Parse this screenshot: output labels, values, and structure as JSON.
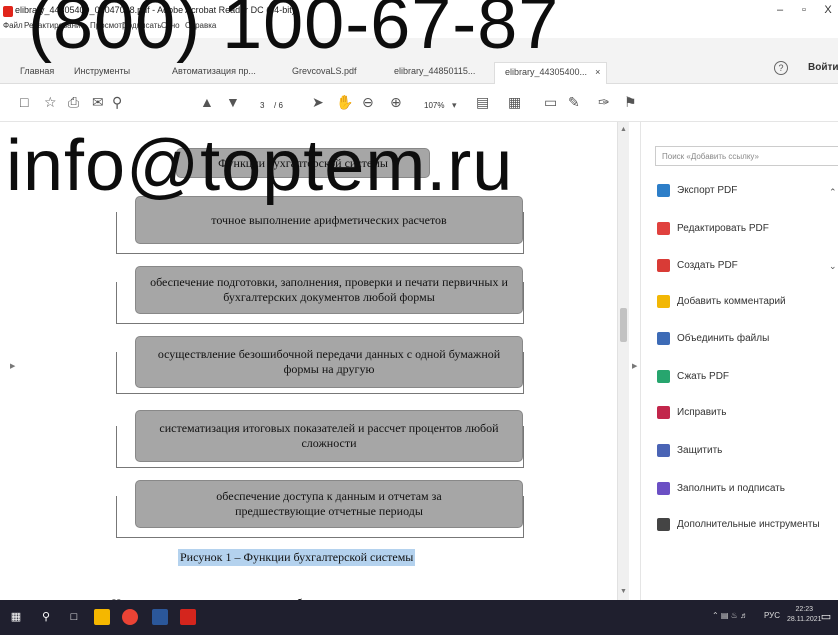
{
  "window": {
    "title": "elibrary_44305400_00047008.pdf - Adobe Acrobat Reader DC (64-bit)",
    "minimize": "–",
    "maximize": "▫",
    "close": "X"
  },
  "menu": [
    "Файл",
    "Редактирование",
    "Просмотр",
    "Подписать",
    "Окно",
    "Справка"
  ],
  "tabs": {
    "home": "Главная",
    "tools": "Инструменты",
    "docs": [
      "Автоматизация пр...",
      "GrevcovaLS.pdf",
      "elibrary_44850115...",
      "elibrary_44305400..."
    ],
    "close_symbol": "×",
    "help": "?",
    "signin": "Войти"
  },
  "toolbar": {
    "page_current": "3",
    "page_total": "/ 6",
    "zoom": "107%"
  },
  "document": {
    "header_box": "Функции бухгалтерской системы",
    "boxes": [
      "точное выполнение арифметических расчетов",
      "обеспечение подготовки, заполнения, проверки и печати первичных и бухгалтерских документов любой формы",
      "осуществление безошибочной передачи данных с одной бумажной формы на другую",
      "систематизация итоговых показателей и рассчет процентов любой сложности",
      "обеспечение доступа к данным и отчетам за предшествующие отчетные периоды"
    ],
    "caption": "Рисунок 1 – Функции бухгалтерской системы",
    "body_text": "Несмотря на уникальность ведения бухгалтерского учета на предприятии"
  },
  "right_panel": {
    "search_placeholder": "Поиск «Добавить ссылку»",
    "tools": [
      {
        "label": "Экспорт PDF",
        "icon": "export-pdf-icon",
        "color": "#2d7ec8"
      },
      {
        "label": "Редактировать PDF",
        "icon": "edit-pdf-icon",
        "color": "#e0413e"
      },
      {
        "label": "Создать PDF",
        "icon": "create-pdf-icon",
        "color": "#d93b36"
      },
      {
        "label": "Добавить комментарий",
        "icon": "comment-icon",
        "color": "#f2b705"
      },
      {
        "label": "Объединить файлы",
        "icon": "combine-files-icon",
        "color": "#3d6bb6"
      },
      {
        "label": "Сжать PDF",
        "icon": "compress-pdf-icon",
        "color": "#27a56e"
      },
      {
        "label": "Исправить",
        "icon": "redact-icon",
        "color": "#c2264b"
      },
      {
        "label": "Защитить",
        "icon": "protect-icon",
        "color": "#4a64b5"
      },
      {
        "label": "Заполнить и подписать",
        "icon": "fill-sign-icon",
        "color": "#6b4fc4"
      },
      {
        "label": "Дополнительные инструменты",
        "icon": "more-tools-icon",
        "color": "#444444"
      }
    ]
  },
  "taskbar": {
    "lang": "РУС",
    "time": "22:23",
    "date": "28.11.2021"
  },
  "watermark": {
    "phone": "(800) 100-67-87",
    "email": "info@toptem.ru"
  }
}
